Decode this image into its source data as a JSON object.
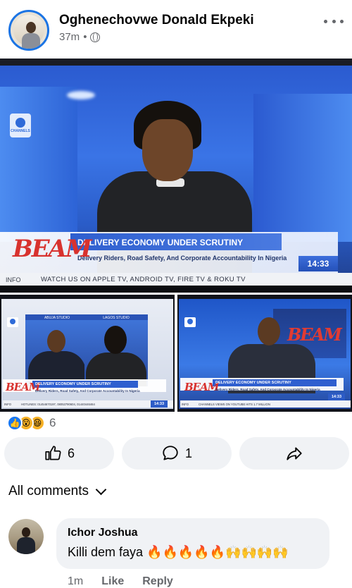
{
  "post": {
    "author": "Oghenechovwe Donald Ekpeki",
    "time": "37m",
    "separator": "•",
    "privacy_icon": "globe-icon",
    "more_icon": "more-options-icon"
  },
  "photos": {
    "main": {
      "channel_logo_text": "CHANNELS",
      "show_name": "BEAM",
      "headline": "DELIVERY ECONOMY UNDER SCRUTINY",
      "subheadline": "Delivery Riders, Road Safety, And Corporate Accountability In Nigeria",
      "ticker_label": "INFO",
      "ticker_text": "WATCH US ON APPLE TV, ANDROID TV, FIRE TV & ROKU TV",
      "clock": "14:33"
    },
    "left": {
      "studio_left": "ABUJA STUDIO",
      "studio_right": "LAGOS STUDIO",
      "show_name": "BEAM",
      "headline": "DELIVERY ECONOMY UNDER SCRUTINY",
      "subheadline": "Delivery Riders, Road Safety, And Corporate Accountability In Nigeria",
      "ticker_label": "INFO",
      "ticker_text": "HOTLINES: 01454670197, 08053790604, 01440446464",
      "clock": "14:33"
    },
    "right": {
      "show_name": "BEAM",
      "headline": "DELIVERY ECONOMY UNDER SCRUTINY",
      "subheadline": "Delivery Riders, Road Safety, And Corporate Accountability In Nigeria",
      "ticker_label": "INFO",
      "ticker_text": "CHANNELS VIEWS ON YOUTUBE HITS 1.7 MILLION",
      "clock": "14:33"
    }
  },
  "reactions": {
    "icons": [
      "like-icon",
      "wow-icon",
      "haha-icon"
    ],
    "like_glyph": "👍",
    "wow_glyph": "😮",
    "haha_glyph": "😆",
    "count": "6"
  },
  "actions": {
    "like_count": "6",
    "comment_count": "1",
    "icons": [
      "like-icon",
      "comment-icon",
      "share-icon"
    ]
  },
  "comments": {
    "filter_label": "All comments",
    "items": [
      {
        "name": "Ichor Joshua",
        "text": "Killi dem faya 🔥🔥🔥🔥🔥🙌🙌🙌🙌",
        "time": "1m",
        "like_label": "Like",
        "reply_label": "Reply"
      }
    ]
  },
  "colors": {
    "accent": "#1877f2",
    "secondary_text": "#65676b",
    "button_bg": "#f0f2f5"
  }
}
